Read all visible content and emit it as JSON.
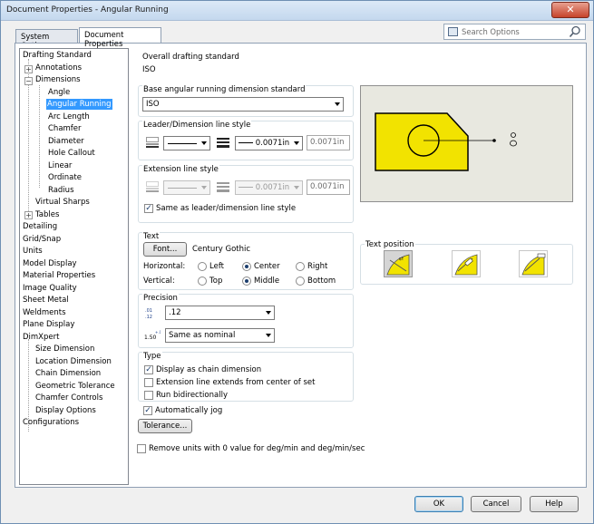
{
  "window": {
    "title": "Document Properties - Angular Running",
    "close_label": "✕"
  },
  "tabs": {
    "system": "System Options",
    "document": "Document Properties"
  },
  "search": {
    "placeholder": "Search Options"
  },
  "tree": {
    "items": [
      {
        "label": "Drafting Standard"
      },
      {
        "label": "Annotations"
      },
      {
        "label": "Dimensions"
      },
      {
        "label": "Angle"
      },
      {
        "label": "Angular Running"
      },
      {
        "label": "Arc Length"
      },
      {
        "label": "Chamfer"
      },
      {
        "label": "Diameter"
      },
      {
        "label": "Hole Callout"
      },
      {
        "label": "Linear"
      },
      {
        "label": "Ordinate"
      },
      {
        "label": "Radius"
      },
      {
        "label": "Virtual Sharps"
      },
      {
        "label": "Tables"
      },
      {
        "label": "Detailing"
      },
      {
        "label": "Grid/Snap"
      },
      {
        "label": "Units"
      },
      {
        "label": "Model Display"
      },
      {
        "label": "Material Properties"
      },
      {
        "label": "Image Quality"
      },
      {
        "label": "Sheet Metal"
      },
      {
        "label": "Weldments"
      },
      {
        "label": "Plane Display"
      },
      {
        "label": "DimXpert"
      },
      {
        "label": "Size Dimension"
      },
      {
        "label": "Location Dimension"
      },
      {
        "label": "Chain Dimension"
      },
      {
        "label": "Geometric Tolerance"
      },
      {
        "label": "Chamfer Controls"
      },
      {
        "label": "Display Options"
      },
      {
        "label": "Configurations"
      }
    ]
  },
  "overall": {
    "label": "Overall drafting standard",
    "value": "ISO"
  },
  "base_std": {
    "label": "Base angular running dimension standard",
    "value": "ISO"
  },
  "leader": {
    "label": "Leader/Dimension line style",
    "thickness": "0.0071in",
    "custom": "0.0071in"
  },
  "extension": {
    "label": "Extension line style",
    "thickness": "0.0071in",
    "custom": "0.0071in",
    "same_label": "Same as leader/dimension line style"
  },
  "text": {
    "label": "Text",
    "font_button": "Font...",
    "font_name": "Century Gothic",
    "horizontal_label": "Horizontal:",
    "h_left": "Left",
    "h_center": "Center",
    "h_right": "Right",
    "vertical_label": "Vertical:",
    "v_top": "Top",
    "v_middle": "Middle",
    "v_bottom": "Bottom"
  },
  "text_position": {
    "label": "Text position"
  },
  "precision": {
    "label": "Precision",
    "primary": ".12",
    "tolerance": "Same as nominal",
    "icon1_text": ".01 .12",
    "icon2_text": "1.50"
  },
  "type": {
    "label": "Type",
    "chain": "Display as chain dimension",
    "extends": "Extension line extends from center of set",
    "bidir": "Run bidirectionally"
  },
  "autojog": {
    "label": "Automatically jog"
  },
  "tolerance_button": "Tolerance...",
  "remove_units": "Remove units with 0 value for deg/min and deg/min/sec",
  "footer": {
    "ok": "OK",
    "cancel": "Cancel",
    "help": "Help"
  },
  "colors": {
    "accent": "#3399ff",
    "preview_fill": "#f2e300",
    "preview_bg": "#e8e8e0"
  },
  "icons": [
    "search-icon",
    "line-thickness-icon",
    "line-style-icon",
    "text-position-icon"
  ]
}
